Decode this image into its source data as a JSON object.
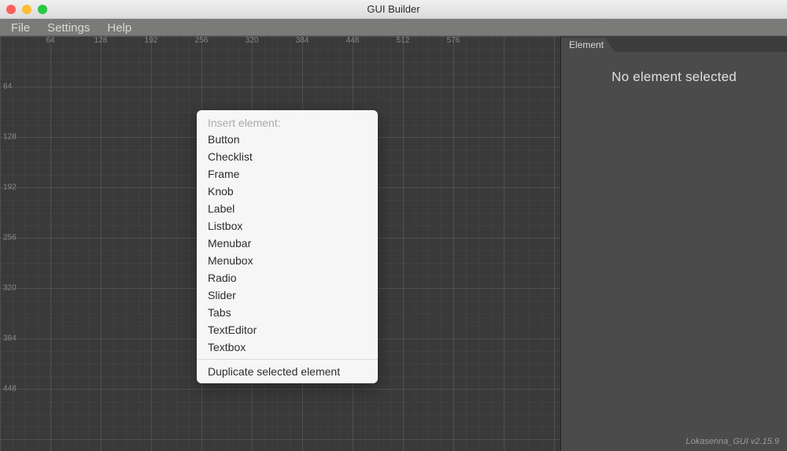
{
  "window": {
    "title": "GUI Builder"
  },
  "menubar": {
    "items": [
      "File",
      "Settings",
      "Help"
    ]
  },
  "ruler": {
    "x": [
      "64",
      "128",
      "192",
      "256",
      "320",
      "384",
      "448",
      "512",
      "576"
    ],
    "y": [
      "64",
      "128",
      "192",
      "256",
      "320",
      "384",
      "448"
    ]
  },
  "context_menu": {
    "header": "Insert element:",
    "items": [
      "Button",
      "Checklist",
      "Frame",
      "Knob",
      "Label",
      "Listbox",
      "Menubar",
      "Menubox",
      "Radio",
      "Slider",
      "Tabs",
      "TextEditor",
      "Textbox"
    ],
    "secondary": "Duplicate selected element"
  },
  "sidebar": {
    "tab": "Element",
    "empty_message": "No element selected"
  },
  "version": "Lokasenna_GUI v2.15.9"
}
